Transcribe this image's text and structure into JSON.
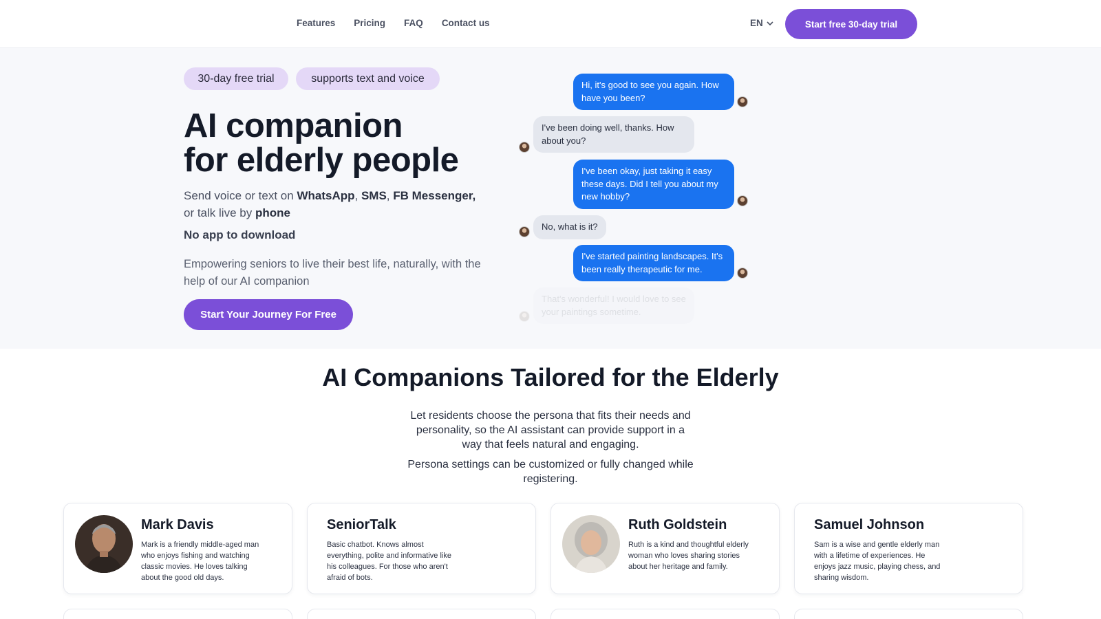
{
  "header": {
    "nav": [
      "Features",
      "Pricing",
      "FAQ",
      "Contact us"
    ],
    "language": "EN",
    "cta": "Start free 30-day trial"
  },
  "hero": {
    "badges": [
      "30-day free trial",
      "supports text and voice"
    ],
    "title_line1": "AI companion",
    "title_line2": "for elderly people",
    "sub_parts": {
      "p1": "Send voice or text on ",
      "whatsapp": "WhatsApp",
      "comma1": ", ",
      "sms": "SMS",
      "comma2": ", ",
      "fb": "FB Messenger,",
      "p2": " or talk live by ",
      "phone": "phone"
    },
    "no_app": "No app to download",
    "description": "Empowering seniors to live their best life, naturally, with the help of our AI companion",
    "cta": "Start Your Journey For Free"
  },
  "chat": [
    {
      "side": "out",
      "text": "Hi, it's good to see you again. How have you been?"
    },
    {
      "side": "in",
      "text": "I've been doing well, thanks. How about you?"
    },
    {
      "side": "out",
      "text": "I've been okay, just taking it easy these days. Did I tell you about my new hobby?"
    },
    {
      "side": "in",
      "text": "No, what is it?"
    },
    {
      "side": "out",
      "text": "I've started painting landscapes. It's been really therapeutic for me."
    },
    {
      "side": "in",
      "text": "That's wonderful! I would love to see your paintings sometime."
    }
  ],
  "section": {
    "title": "AI Companions Tailored for the Elderly",
    "p1": "Let residents choose the persona that fits their needs and personality, so the AI assistant can provide support in a way that feels natural and engaging.",
    "p2": "Persona settings can be customized or fully changed while registering."
  },
  "personas": [
    {
      "name": "Mark Davis",
      "desc": "Mark is a friendly middle-aged man who enjoys fishing and watching classic movies. He loves talking about the good old days.",
      "photo": "man-portrait"
    },
    {
      "name": "SeniorTalk",
      "desc": "Basic chatbot. Knows almost everything, polite and informative like his colleagues. For those who aren't afraid of bots.",
      "photo": ""
    },
    {
      "name": "Ruth Goldstein",
      "desc": "Ruth is a kind and thoughtful elderly woman who loves sharing stories about her heritage and family.",
      "photo": "woman-portrait"
    },
    {
      "name": "Samuel Johnson",
      "desc": "Sam is a wise and gentle elderly man with a lifetime of experiences. He enjoys jazz music, playing chess, and sharing wisdom.",
      "photo": ""
    }
  ],
  "colors": {
    "accent": "#7b4fd8",
    "badge_bg": "#e4d8f7",
    "chat_out": "#1a73f0",
    "chat_in": "#e4e7ee"
  }
}
